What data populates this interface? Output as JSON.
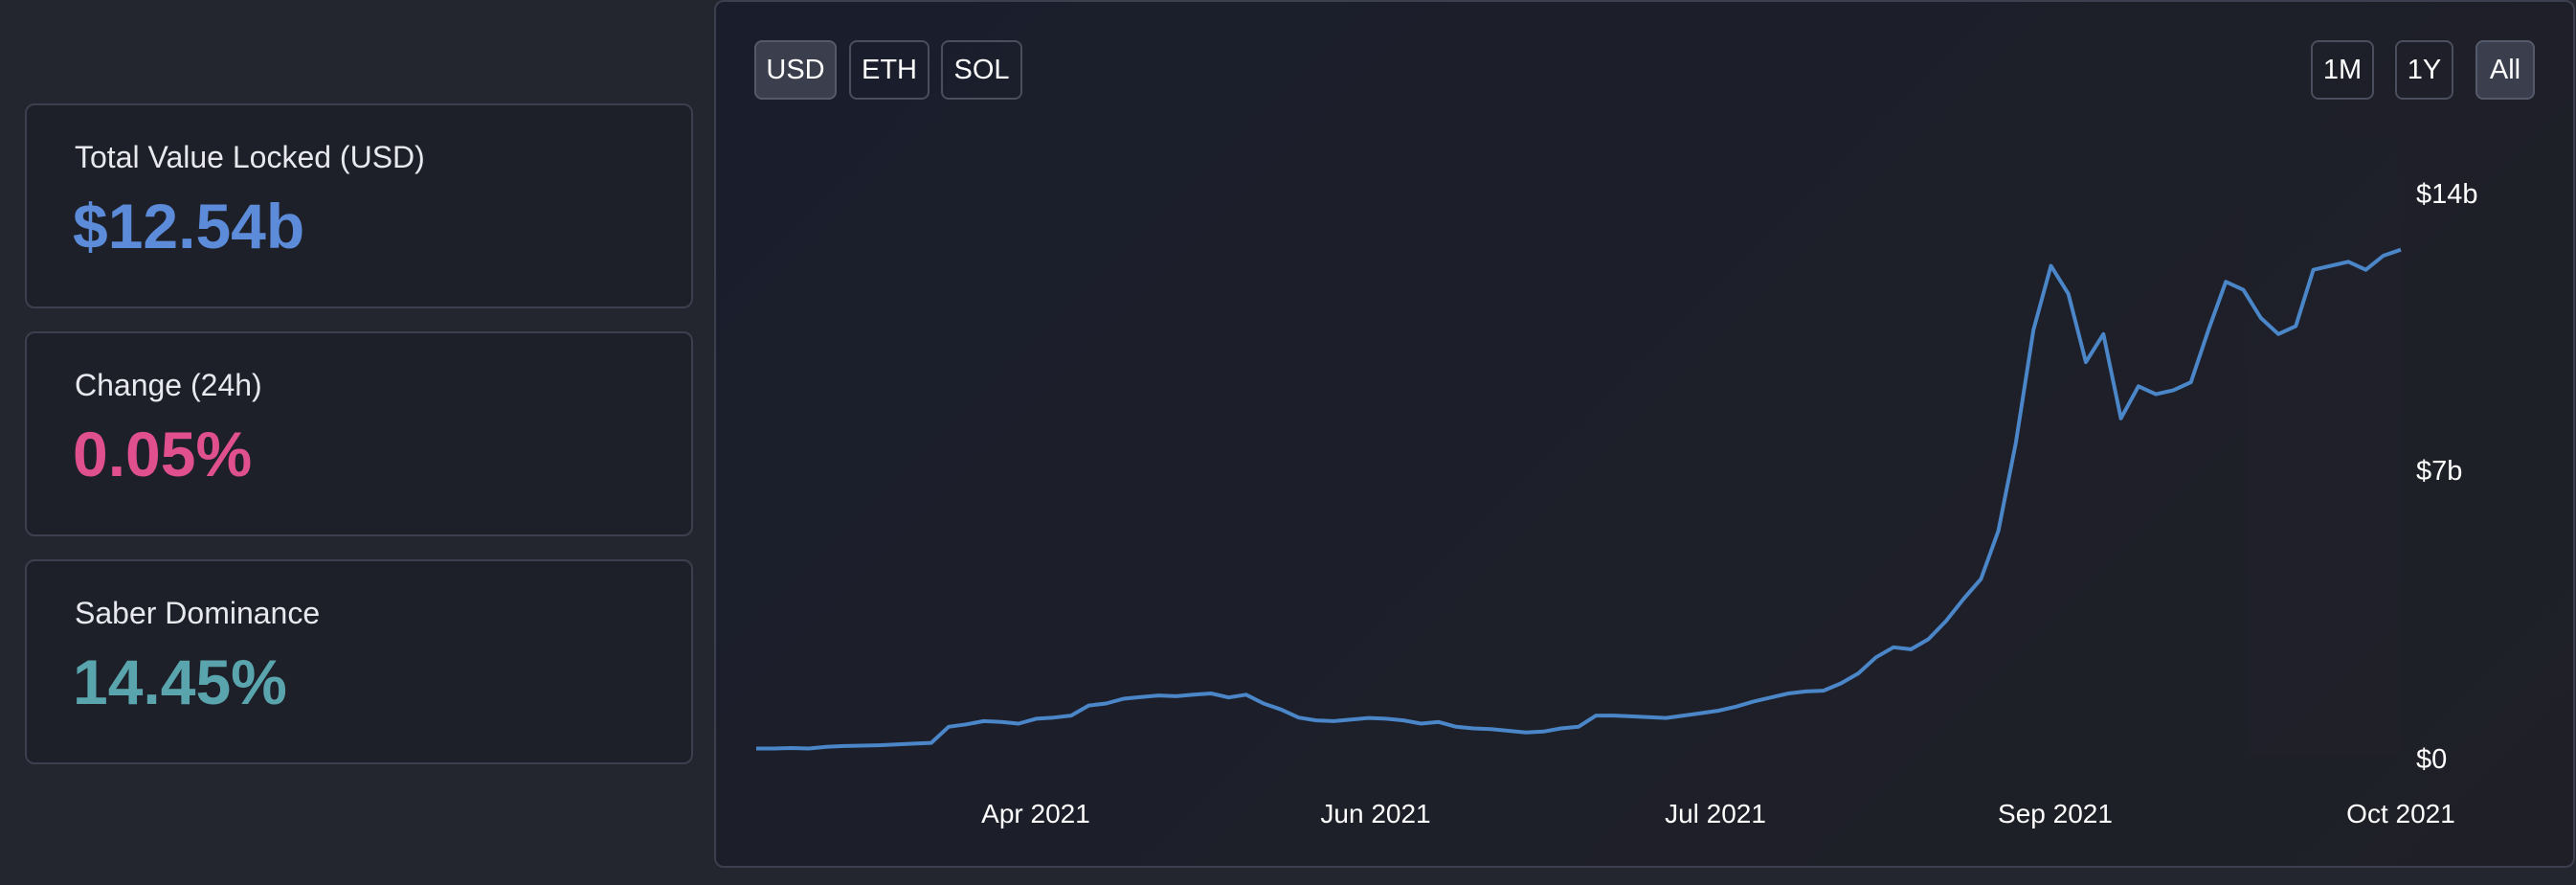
{
  "stats": [
    {
      "label": "Total Value Locked (USD)",
      "value": "$12.54b",
      "color": "#5b8bd9"
    },
    {
      "label": "Change (24h)",
      "value": "0.05%",
      "color": "#e0508f"
    },
    {
      "label": "Saber Dominance",
      "value": "14.45%",
      "color": "#5aa5ad"
    }
  ],
  "currency_buttons": [
    {
      "label": "USD",
      "active": true
    },
    {
      "label": "ETH",
      "active": false
    },
    {
      "label": "SOL",
      "active": false
    }
  ],
  "range_buttons": [
    {
      "label": "1M",
      "active": false
    },
    {
      "label": "1Y",
      "active": false
    },
    {
      "label": "All",
      "active": true
    }
  ],
  "colors": {
    "line": "#4a86c8",
    "axis_text": "#ffffff"
  },
  "chart_data": {
    "type": "line",
    "title": "",
    "xlabel": "",
    "ylabel": "",
    "x_ticks": [
      "Apr 2021",
      "Jun 2021",
      "Jul 2021",
      "Sep 2021",
      "Oct 2021"
    ],
    "y_ticks": [
      "$0",
      "$7b",
      "$14b"
    ],
    "ylim": [
      0,
      14
    ],
    "y_unit": "billion USD",
    "grid": false,
    "legend": "none",
    "series": [
      {
        "values": [
          0.18,
          0.18,
          0.19,
          0.18,
          0.22,
          0.24,
          0.25,
          0.26,
          0.28,
          0.3,
          0.32,
          0.72,
          0.78,
          0.86,
          0.84,
          0.8,
          0.92,
          0.95,
          1.0,
          1.25,
          1.3,
          1.42,
          1.46,
          1.5,
          1.48,
          1.52,
          1.55,
          1.45,
          1.52,
          1.3,
          1.15,
          0.95,
          0.88,
          0.86,
          0.9,
          0.94,
          0.92,
          0.88,
          0.8,
          0.84,
          0.72,
          0.68,
          0.66,
          0.62,
          0.58,
          0.6,
          0.68,
          0.72,
          1.0,
          1.0,
          0.98,
          0.96,
          0.94,
          1.0,
          1.06,
          1.12,
          1.22,
          1.35,
          1.45,
          1.55,
          1.6,
          1.62,
          1.8,
          2.05,
          2.45,
          2.7,
          2.65,
          2.9,
          3.35,
          3.9,
          4.4,
          5.6,
          7.8,
          10.6,
          12.2,
          11.5,
          9.8,
          10.5,
          8.4,
          9.2,
          9.0,
          9.1,
          9.3,
          10.6,
          11.8,
          11.6,
          10.9,
          10.5,
          10.7,
          12.1,
          12.2,
          12.3,
          12.1,
          12.45,
          12.6
        ]
      }
    ]
  }
}
